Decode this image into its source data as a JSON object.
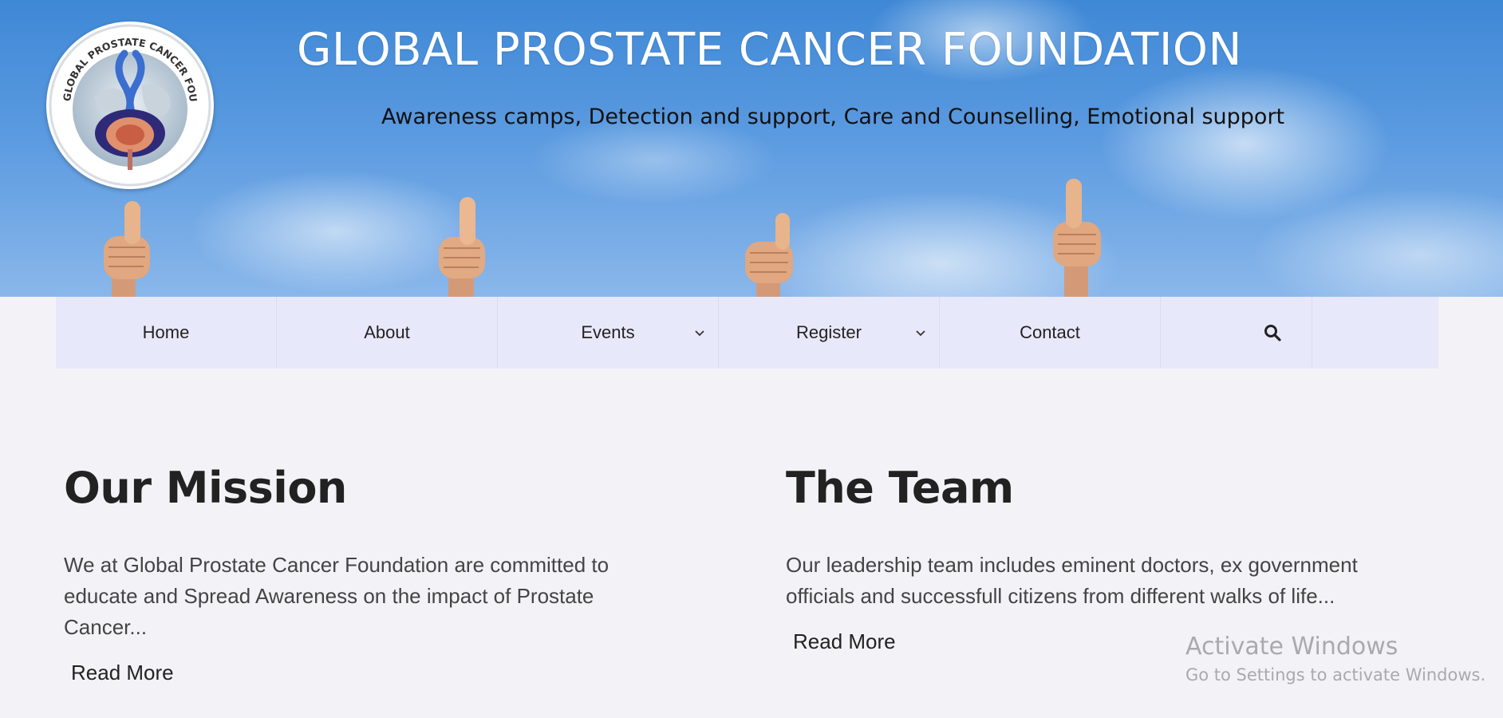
{
  "header": {
    "title": "GLOBAL PROSTATE CANCER FOUNDATION",
    "tagline": "Awareness camps, Detection and support, Care and Counselling, Emotional support",
    "logo_text": "GLOBAL PROSTATE CANCER FOUNDATION"
  },
  "nav": {
    "items": [
      {
        "label": "Home"
      },
      {
        "label": "About"
      },
      {
        "label": "Events"
      },
      {
        "label": "Register"
      },
      {
        "label": "Contact"
      }
    ],
    "search_icon": "search-icon"
  },
  "mission": {
    "heading": "Our Mission",
    "body": "We at Global Prostate Cancer Foundation are committed to educate and Spread Awareness on the impact of Prostate Cancer...",
    "read_more": "Read More"
  },
  "team": {
    "heading": "The Team",
    "body": "Our leadership team includes eminent doctors, ex government officials and successfull citizens from different walks of life...",
    "read_more": "Read More"
  },
  "watermark": {
    "line1": "Activate Windows",
    "line2": "Go to Settings to activate Windows."
  },
  "colors": {
    "sky": "#3f88d6",
    "nav_bg": "#e8e8fb",
    "page_bg": "#f3f2f6",
    "ribbon": "#3a6fd0"
  }
}
